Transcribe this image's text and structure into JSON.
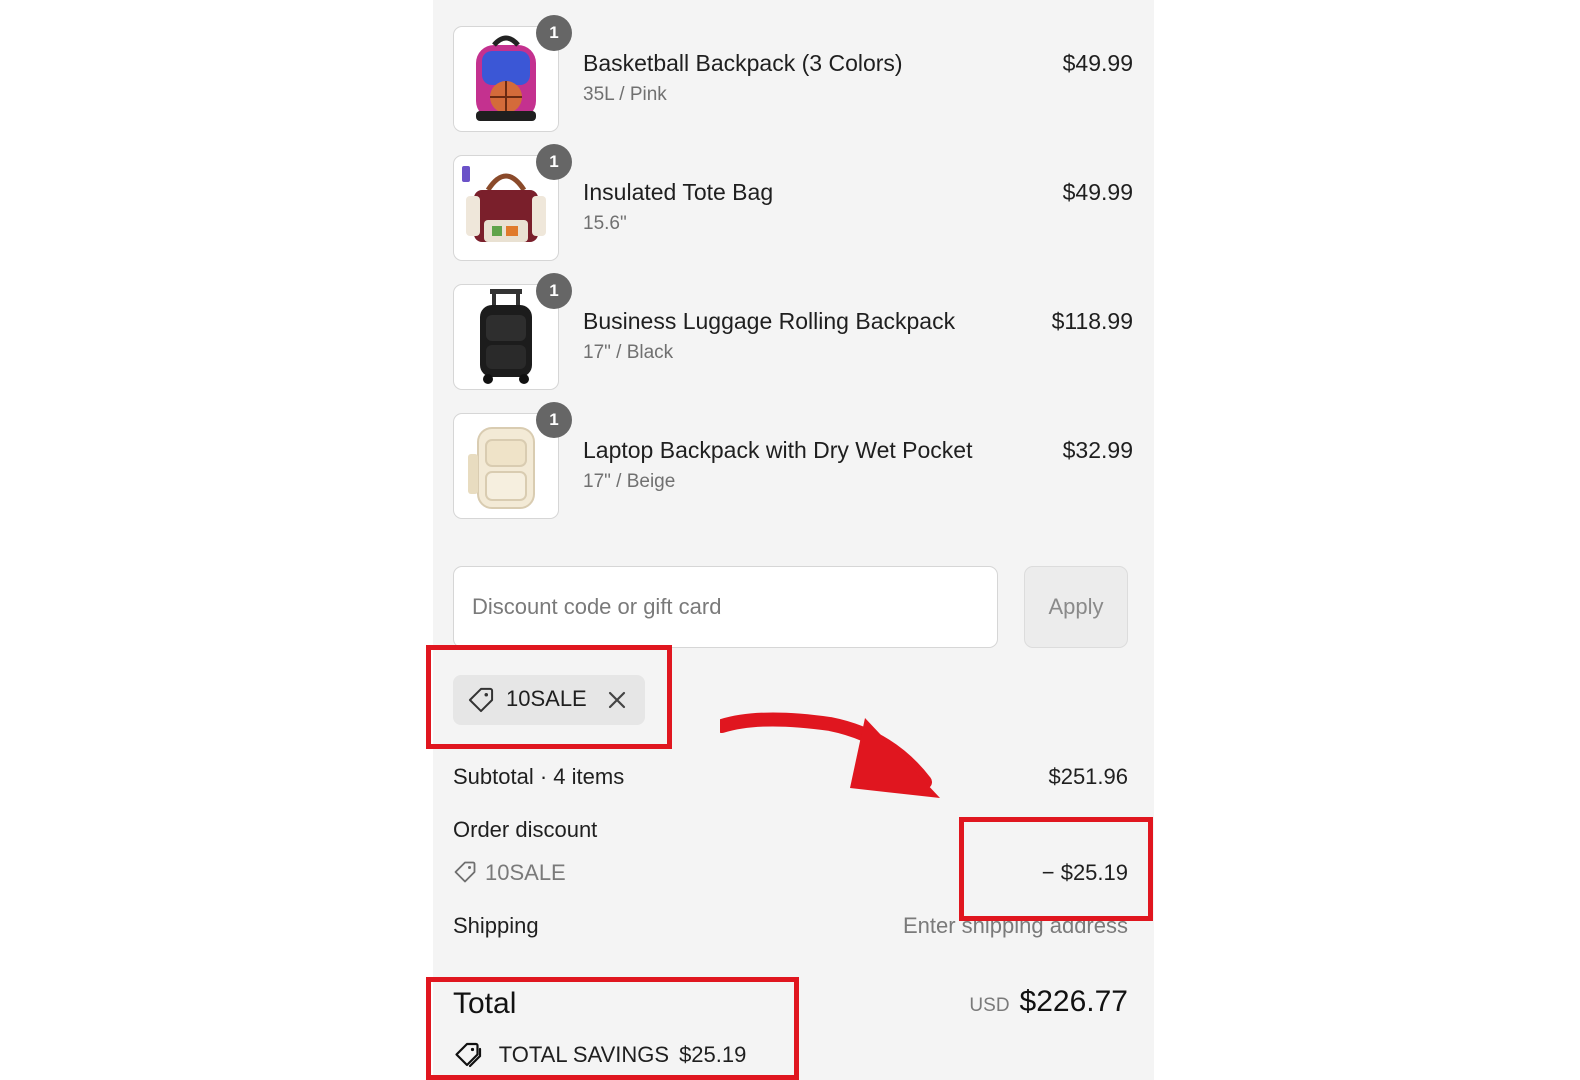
{
  "cart": {
    "items": [
      {
        "title": "Basketball Backpack (3 Colors)",
        "variant": "35L / Pink",
        "price": "$49.99",
        "quantity": "1",
        "image_icon": "backpack-pink-icon"
      },
      {
        "title": "Insulated Tote Bag",
        "variant": "15.6\"",
        "price": "$49.99",
        "quantity": "1",
        "image_icon": "tote-bag-icon"
      },
      {
        "title": "Business Luggage Rolling Backpack",
        "variant": "17\" / Black",
        "price": "$118.99",
        "quantity": "1",
        "image_icon": "rolling-backpack-icon"
      },
      {
        "title": "Laptop Backpack with Dry Wet Pocket",
        "variant": "17\" / Beige",
        "price": "$32.99",
        "quantity": "1",
        "image_icon": "laptop-backpack-icon"
      }
    ]
  },
  "discount": {
    "placeholder": "Discount code or gift card",
    "apply_label": "Apply",
    "applied_code": "10SALE"
  },
  "summary": {
    "subtotal_label": "Subtotal · 4 items",
    "subtotal_value": "$251.96",
    "order_discount_label": "Order discount",
    "discount_code": "10SALE",
    "discount_value": "− $25.19",
    "shipping_label": "Shipping",
    "shipping_value": "Enter shipping address",
    "total_label": "Total",
    "currency": "USD",
    "total_value": "$226.77",
    "savings_label": "TOTAL SAVINGS",
    "savings_value": "$25.19"
  },
  "colors": {
    "annotation": "#e0161f",
    "panel_bg": "#f4f4f4",
    "badge": "#666666"
  }
}
